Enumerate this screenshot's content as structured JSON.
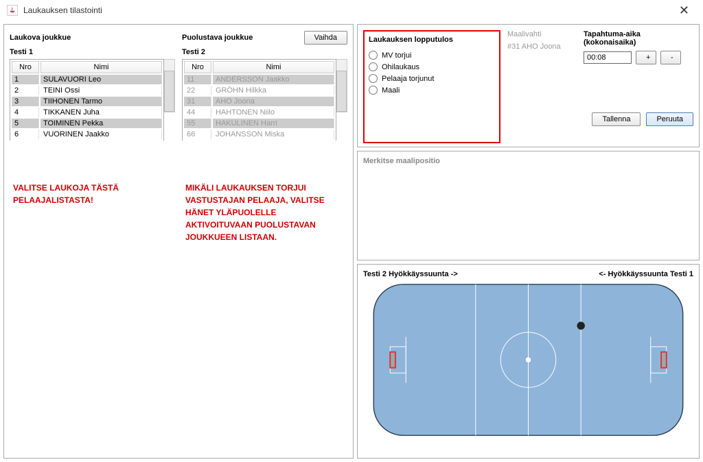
{
  "window": {
    "title": "Laukauksen tilastointi"
  },
  "left": {
    "shooting_label": "Laukova joukkue",
    "defending_label": "Puolustava joukkue",
    "switch_btn": "Vaihda",
    "team1": "Testi 1",
    "team2": "Testi 2",
    "col_nro": "Nro",
    "col_nimi": "Nimi",
    "players1": [
      {
        "nro": "1",
        "nimi": "SULAVUORI Leo"
      },
      {
        "nro": "2",
        "nimi": "TEINI Ossi"
      },
      {
        "nro": "3",
        "nimi": "TIIHONEN Tarmo"
      },
      {
        "nro": "4",
        "nimi": "TIKKANEN Juha"
      },
      {
        "nro": "5",
        "nimi": "TOIMINEN Pekka"
      },
      {
        "nro": "6",
        "nimi": "VUORINEN Jaakko"
      }
    ],
    "players2": [
      {
        "nro": "11",
        "nimi": "ANDERSSON Jaakko"
      },
      {
        "nro": "22",
        "nimi": "GRÖHN Hilkka"
      },
      {
        "nro": "31",
        "nimi": "AHO Joona"
      },
      {
        "nro": "44",
        "nimi": "HAHTONEN Niilo"
      },
      {
        "nro": "55",
        "nimi": "HAKULINEN Harri"
      },
      {
        "nro": "66",
        "nimi": "JOHANSSON Miska"
      }
    ],
    "hint1": "VALITSE LAUKOJA TÄSTÄ PELAAJALISTASTA!",
    "hint2": "MIKÄLI LAUKAUKSEN TORJUI VASTUSTAJAN PELAAJA, VALITSE HÄNET YLÄPUOLELLE AKTIVOITUVAAN PUOLUSTAVAN JOUKKUEEN LISTAAN."
  },
  "outcome": {
    "title": "Laukauksen lopputulos",
    "o1": "MV torjui",
    "o2": "Ohilaukaus",
    "o3": "Pelaaja torjunut",
    "o4": "Maali"
  },
  "goalie": {
    "label": "Maalivahti",
    "name": "#31 AHO Joona"
  },
  "time": {
    "label": "Tapahtuma-aika (kokonaisaika)",
    "value": "00:08",
    "plus": "+",
    "minus": "-"
  },
  "actions": {
    "save": "Tallenna",
    "cancel": "Peruuta"
  },
  "mark": {
    "label": "Merkitse maalipositio"
  },
  "rink": {
    "left": "Testi 2 Hyökkäyssuunta ->",
    "right": "<- Hyökkäyssuunta Testi 1"
  }
}
